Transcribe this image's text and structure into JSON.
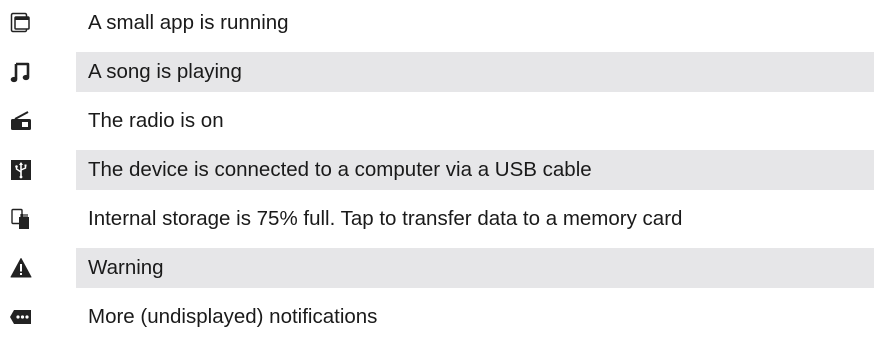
{
  "rows": [
    {
      "icon": "small-app-icon",
      "text": "A small app is running"
    },
    {
      "icon": "music-note-icon",
      "text": "A song is playing"
    },
    {
      "icon": "radio-icon",
      "text": "The radio is on"
    },
    {
      "icon": "usb-icon",
      "text": "The device is connected to a computer via a USB cable"
    },
    {
      "icon": "storage-transfer-icon",
      "text": "Internal storage is 75% full. Tap to transfer data to a memory card"
    },
    {
      "icon": "warning-icon",
      "text": "Warning"
    },
    {
      "icon": "more-notifications-icon",
      "text": "More (undisplayed) notifications"
    }
  ],
  "colors": {
    "shade": "#e6e6e8",
    "icon": "#222222",
    "text": "#1a1a1a"
  }
}
